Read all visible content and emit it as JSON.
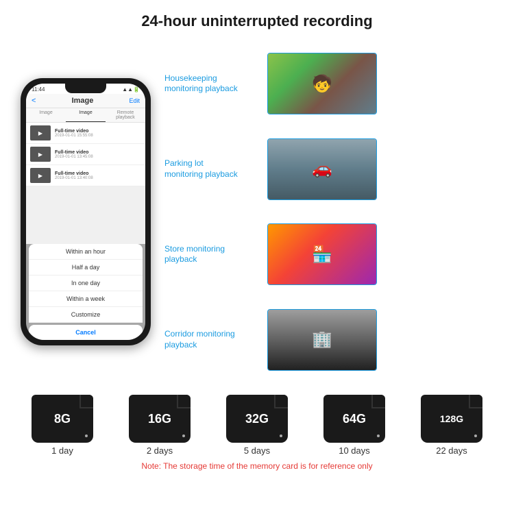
{
  "header": {
    "title": "24-hour uninterrupted recording"
  },
  "phone": {
    "status_time": "11:44",
    "app_back": "<",
    "app_title": "Image",
    "app_edit": "Edit",
    "tabs": [
      "Image",
      "Image",
      "Remote playback"
    ],
    "video_items": [
      {
        "title": "Full-time video",
        "date": "2019-01-01 15:55:08"
      },
      {
        "title": "Full-time video",
        "date": "2019-01-01 13:45:08"
      },
      {
        "title": "Full-time video",
        "date": "2019-01-01 13:40:08"
      }
    ],
    "dropdown_items": [
      "Within an hour",
      "Half a day",
      "In one day",
      "Within a week",
      "Customize"
    ],
    "dropdown_cancel": "Cancel"
  },
  "monitoring": [
    {
      "label": "Housekeeping\nmonitoring playback",
      "img_type": "housekeeping",
      "emoji": "🧒"
    },
    {
      "label": "Parking lot\nmonitoring playback",
      "img_type": "parking",
      "emoji": "🚗"
    },
    {
      "label": "Store monitoring\nplayback",
      "img_type": "store",
      "emoji": "🏪"
    },
    {
      "label": "Corridor monitoring\nplayback",
      "img_type": "corridor",
      "emoji": "🏢"
    }
  ],
  "storage_cards": [
    {
      "size": "8G",
      "days": "1 day"
    },
    {
      "size": "16G",
      "days": "2 days"
    },
    {
      "size": "32G",
      "days": "5 days"
    },
    {
      "size": "64G",
      "days": "10 days"
    },
    {
      "size": "128G",
      "days": "22 days"
    }
  ],
  "note": "Note: The storage time of the memory card is for reference only"
}
